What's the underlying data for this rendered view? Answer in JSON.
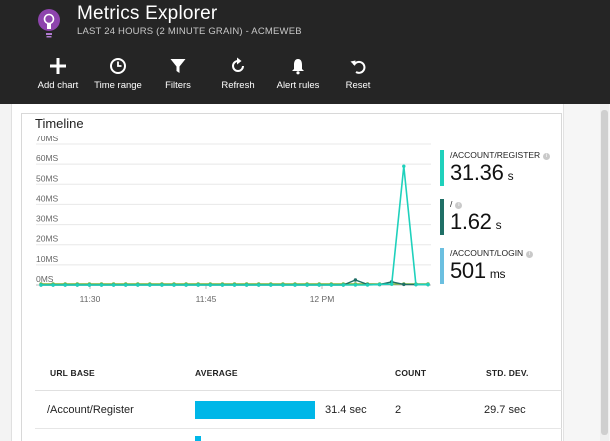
{
  "header": {
    "title": "Metrics Explorer",
    "subtitle": "LAST 24 HOURS (2 MINUTE GRAIN) - ACMEWEB",
    "app_icon": "lightbulb-icon"
  },
  "toolbar": [
    {
      "label": "Add chart",
      "icon": "plus-icon"
    },
    {
      "label": "Time range",
      "icon": "clock-icon"
    },
    {
      "label": "Filters",
      "icon": "filter-icon"
    },
    {
      "label": "Refresh",
      "icon": "refresh-icon"
    },
    {
      "label": "Alert rules",
      "icon": "bell-icon"
    },
    {
      "label": "Reset",
      "icon": "undo-icon"
    }
  ],
  "timeline": {
    "title": "Timeline"
  },
  "chart_data": {
    "type": "line",
    "x_tick_labels": [
      "11:30",
      "11:45",
      "12 PM"
    ],
    "y_tick_labels": [
      "0MS",
      "10MS",
      "20MS",
      "30MS",
      "40MS",
      "50MS",
      "60MS",
      "70MS"
    ],
    "ylim": [
      0,
      70
    ],
    "grid": true,
    "legend_position": "right",
    "series": [
      {
        "name": "/ACCOUNT/REGISTER",
        "color": "#1fd1bc",
        "values": [
          0,
          0,
          0,
          0,
          0,
          0,
          0,
          0,
          0,
          0,
          0,
          0,
          0,
          0,
          0,
          0,
          0,
          0,
          0,
          0,
          0,
          0,
          0,
          0,
          0,
          0,
          0,
          0,
          0.3,
          0.4,
          59,
          0.2,
          0.2
        ]
      },
      {
        "name": "/",
        "color": "#1f6f66",
        "values": [
          0,
          0,
          0,
          0,
          0,
          0,
          0,
          0,
          0,
          0,
          0,
          0,
          0,
          0,
          0,
          0,
          0,
          0,
          0,
          0,
          0,
          0,
          0,
          0,
          0,
          0,
          2.5,
          0.3,
          0.2,
          1.6,
          0.3,
          0.2,
          0.2
        ]
      },
      {
        "name": "/ACCOUNT/LOGIN",
        "color": "#7bb43c",
        "values": [
          0.5,
          0.5,
          0.5,
          0.5,
          0.5,
          0.5,
          0.5,
          0.5,
          0.5,
          0.5,
          0.5,
          0.5,
          0.5,
          0.5,
          0.5,
          0.5,
          0.5,
          0.5,
          0.5,
          0.5,
          0.5,
          0.5,
          0.5,
          0.5,
          0.5,
          0.5,
          0.5,
          0.5,
          0.5,
          0.5,
          0.5,
          0.5,
          0.5
        ]
      }
    ]
  },
  "legend": [
    {
      "name": "/ACCOUNT/REGISTER",
      "value": "31.36",
      "unit": "s",
      "color": "#1fd1bc"
    },
    {
      "name": "/",
      "value": "1.62",
      "unit": "s",
      "color": "#1f6f66"
    },
    {
      "name": "/ACCOUNT/LOGIN",
      "value": "501",
      "unit": "ms",
      "color": "#6bbfe0"
    }
  ],
  "table": {
    "columns": [
      "URL BASE",
      "AVERAGE",
      "COUNT",
      "STD. DEV."
    ],
    "rows": [
      {
        "url": "/Account/Register",
        "average": "31.4 sec",
        "average_fraction": 1.0,
        "count": "2",
        "std_dev": "29.7 sec"
      },
      {
        "url": "",
        "average": "",
        "average_fraction": 0.05,
        "count": "",
        "std_dev": ""
      }
    ]
  },
  "colors": {
    "header_bg": "#252525",
    "bar": "#00b7e8",
    "icon_purple": "#8e44ad"
  }
}
